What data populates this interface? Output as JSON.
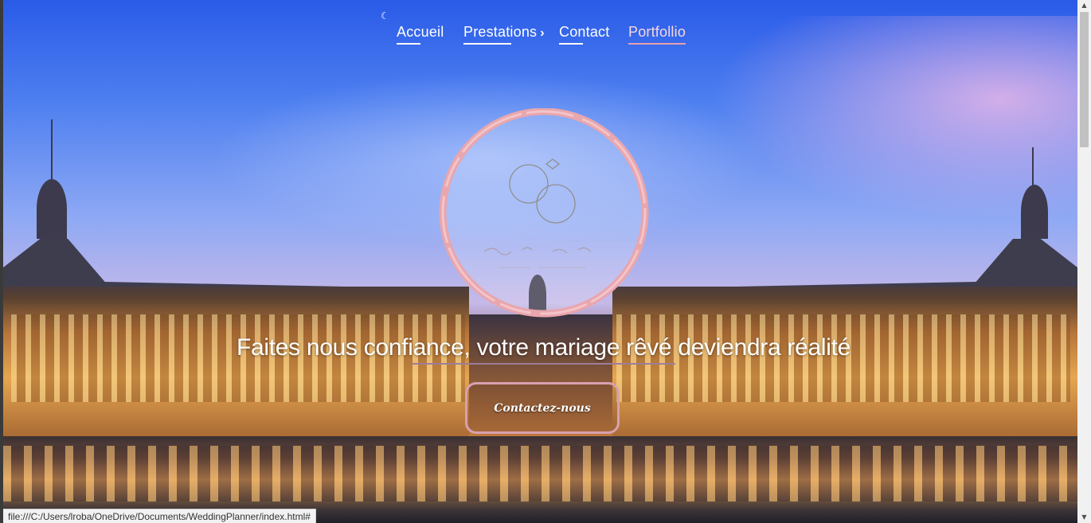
{
  "nav": {
    "items": [
      {
        "label": "Accueil"
      },
      {
        "label": "Prestations"
      },
      {
        "label": "Contact"
      },
      {
        "label": "Portfollio"
      }
    ]
  },
  "hero": {
    "headline": "Faites nous confiance, votre mariage rêvé deviendra réalité",
    "cta_label": "Contactez-nous"
  },
  "status_bar": {
    "url": "file:///C:/Users/lroba/OneDrive/Documents/WeddingPlanner/index.html#"
  },
  "colors": {
    "accent_pink": "#e7a0ae",
    "cta_border": "#d9a0b0",
    "logo_ring": "#e8a6ad"
  },
  "icons": {
    "submenu": "chevron-right-icon",
    "logo": "wedding-rings-icon"
  }
}
